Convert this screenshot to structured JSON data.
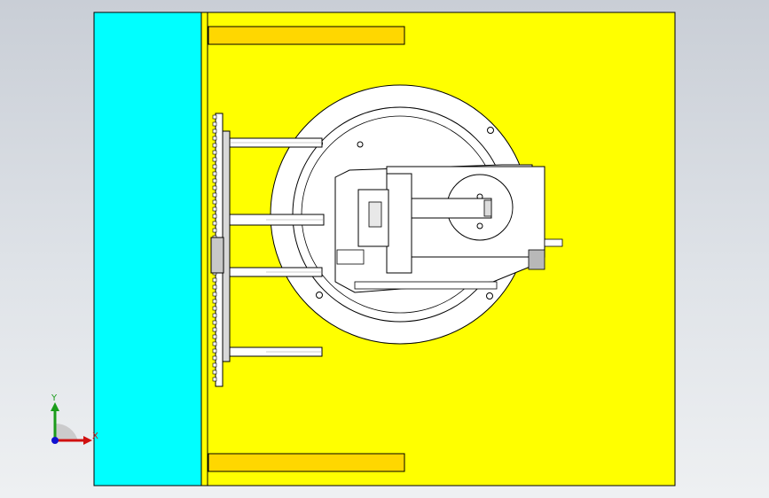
{
  "viewport": {
    "background_top": "#c9ced6",
    "background_bottom": "#eef0f2"
  },
  "model": {
    "plate_color": "#ffff00",
    "side_panel_color": "#00ffff",
    "slot_color": "#ffd700",
    "outline_color": "#000000",
    "part_fill": "#ffffff",
    "shading_color": "#b8b8b8"
  },
  "triad": {
    "y_label": "Y",
    "x_label": "X",
    "y_color": "#1a9c1a",
    "x_color": "#d01010",
    "z_color": "#1010d0"
  }
}
